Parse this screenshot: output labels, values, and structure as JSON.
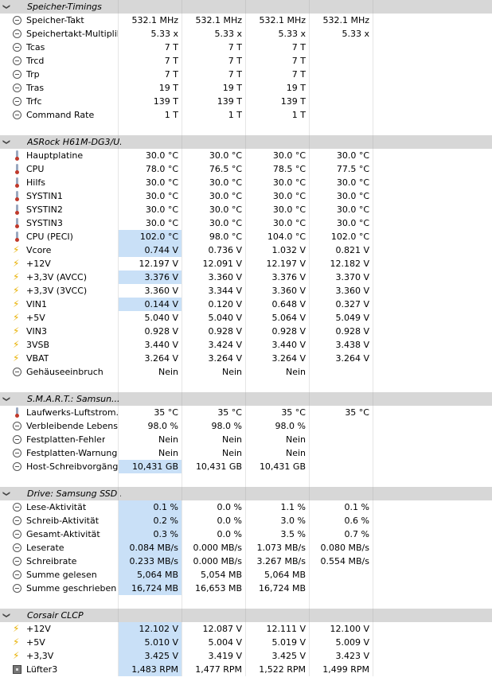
{
  "groups": [
    {
      "title": "Speicher-Timings",
      "rows": [
        {
          "icon": "clock-icon",
          "label": "Speicher-Takt",
          "values": [
            "532.1 MHz",
            "532.1 MHz",
            "532.1 MHz",
            "532.1 MHz"
          ]
        },
        {
          "icon": "clock-icon",
          "label": "Speichertakt-Multiplik...",
          "values": [
            "5.33 x",
            "5.33 x",
            "5.33 x",
            "5.33 x"
          ]
        },
        {
          "icon": "clock-icon",
          "label": "Tcas",
          "values": [
            "7 T",
            "7 T",
            "7 T",
            ""
          ]
        },
        {
          "icon": "clock-icon",
          "label": "Trcd",
          "values": [
            "7 T",
            "7 T",
            "7 T",
            ""
          ]
        },
        {
          "icon": "clock-icon",
          "label": "Trp",
          "values": [
            "7 T",
            "7 T",
            "7 T",
            ""
          ]
        },
        {
          "icon": "clock-icon",
          "label": "Tras",
          "values": [
            "19 T",
            "19 T",
            "19 T",
            ""
          ]
        },
        {
          "icon": "clock-icon",
          "label": "Trfc",
          "values": [
            "139 T",
            "139 T",
            "139 T",
            ""
          ]
        },
        {
          "icon": "clock-icon",
          "label": "Command Rate",
          "values": [
            "1 T",
            "1 T",
            "1 T",
            ""
          ]
        }
      ]
    },
    {
      "title": "ASRock H61M-DG3/U...",
      "rows": [
        {
          "icon": "thermometer-icon",
          "label": "Hauptplatine",
          "values": [
            "30.0 °C",
            "30.0 °C",
            "30.0 °C",
            "30.0 °C"
          ]
        },
        {
          "icon": "thermometer-icon",
          "label": "CPU",
          "values": [
            "78.0 °C",
            "76.5 °C",
            "78.5 °C",
            "77.5 °C"
          ]
        },
        {
          "icon": "thermometer-icon",
          "label": "Hilfs",
          "values": [
            "30.0 °C",
            "30.0 °C",
            "30.0 °C",
            "30.0 °C"
          ]
        },
        {
          "icon": "thermometer-icon",
          "label": "SYSTIN1",
          "values": [
            "30.0 °C",
            "30.0 °C",
            "30.0 °C",
            "30.0 °C"
          ]
        },
        {
          "icon": "thermometer-icon",
          "label": "SYSTIN2",
          "values": [
            "30.0 °C",
            "30.0 °C",
            "30.0 °C",
            "30.0 °C"
          ]
        },
        {
          "icon": "thermometer-icon",
          "label": "SYSTIN3",
          "values": [
            "30.0 °C",
            "30.0 °C",
            "30.0 °C",
            "30.0 °C"
          ]
        },
        {
          "icon": "thermometer-icon",
          "label": "CPU (PECI)",
          "values": [
            "102.0 °C",
            "98.0 °C",
            "104.0 °C",
            "102.0 °C"
          ],
          "hl": true
        },
        {
          "icon": "voltage-icon",
          "label": "Vcore",
          "values": [
            "0.744 V",
            "0.736 V",
            "1.032 V",
            "0.821 V"
          ],
          "hl": true
        },
        {
          "icon": "voltage-icon",
          "label": "+12V",
          "values": [
            "12.197 V",
            "12.091 V",
            "12.197 V",
            "12.182 V"
          ]
        },
        {
          "icon": "voltage-icon",
          "label": "+3,3V (AVCC)",
          "values": [
            "3.376 V",
            "3.360 V",
            "3.376 V",
            "3.370 V"
          ],
          "hl": true
        },
        {
          "icon": "voltage-icon",
          "label": "+3,3V (3VCC)",
          "values": [
            "3.360 V",
            "3.344 V",
            "3.360 V",
            "3.360 V"
          ]
        },
        {
          "icon": "voltage-icon",
          "label": "VIN1",
          "values": [
            "0.144 V",
            "0.120 V",
            "0.648 V",
            "0.327 V"
          ],
          "hl": true
        },
        {
          "icon": "voltage-icon",
          "label": "+5V",
          "values": [
            "5.040 V",
            "5.040 V",
            "5.064 V",
            "5.049 V"
          ]
        },
        {
          "icon": "voltage-icon",
          "label": "VIN3",
          "values": [
            "0.928 V",
            "0.928 V",
            "0.928 V",
            "0.928 V"
          ]
        },
        {
          "icon": "voltage-icon",
          "label": "3VSB",
          "values": [
            "3.440 V",
            "3.424 V",
            "3.440 V",
            "3.438 V"
          ]
        },
        {
          "icon": "voltage-icon",
          "label": "VBAT",
          "values": [
            "3.264 V",
            "3.264 V",
            "3.264 V",
            "3.264 V"
          ]
        },
        {
          "icon": "clock-icon",
          "label": "Gehäuseeinbruch",
          "values": [
            "Nein",
            "Nein",
            "Nein",
            ""
          ]
        }
      ]
    },
    {
      "title": "S.M.A.R.T.: Samsun...",
      "rows": [
        {
          "icon": "thermometer-icon",
          "label": "Laufwerks-Luftstrom...",
          "values": [
            "35 °C",
            "35 °C",
            "35 °C",
            "35 °C"
          ]
        },
        {
          "icon": "clock-icon",
          "label": "Verbleibende Lebens...",
          "values": [
            "98.0 %",
            "98.0 %",
            "98.0 %",
            ""
          ]
        },
        {
          "icon": "clock-icon",
          "label": "Festplatten-Fehler",
          "values": [
            "Nein",
            "Nein",
            "Nein",
            ""
          ]
        },
        {
          "icon": "clock-icon",
          "label": "Festplatten-Warnung",
          "values": [
            "Nein",
            "Nein",
            "Nein",
            ""
          ]
        },
        {
          "icon": "clock-icon",
          "label": "Host-Schreibvorgäng...",
          "values": [
            "10,431 GB",
            "10,431 GB",
            "10,431 GB",
            ""
          ],
          "hl": true
        }
      ]
    },
    {
      "title": "Drive: Samsung SSD ...",
      "rows": [
        {
          "icon": "clock-icon",
          "label": "Lese-Aktivität",
          "values": [
            "0.1 %",
            "0.0 %",
            "1.1 %",
            "0.1 %"
          ],
          "hl": true
        },
        {
          "icon": "clock-icon",
          "label": "Schreib-Aktivität",
          "values": [
            "0.2 %",
            "0.0 %",
            "3.0 %",
            "0.6 %"
          ],
          "hl": true
        },
        {
          "icon": "clock-icon",
          "label": "Gesamt-Aktivität",
          "values": [
            "0.3 %",
            "0.0 %",
            "3.5 %",
            "0.7 %"
          ],
          "hl": true
        },
        {
          "icon": "clock-icon",
          "label": "Leserate",
          "values": [
            "0.084 MB/s",
            "0.000 MB/s",
            "1.073 MB/s",
            "0.080 MB/s"
          ],
          "hl": true
        },
        {
          "icon": "clock-icon",
          "label": "Schreibrate",
          "values": [
            "0.233 MB/s",
            "0.000 MB/s",
            "3.267 MB/s",
            "0.554 MB/s"
          ],
          "hl": true
        },
        {
          "icon": "clock-icon",
          "label": "Summe gelesen",
          "values": [
            "5,064 MB",
            "5,054 MB",
            "5,064 MB",
            ""
          ],
          "hl": true
        },
        {
          "icon": "clock-icon",
          "label": "Summe geschrieben",
          "values": [
            "16,724 MB",
            "16,653 MB",
            "16,724 MB",
            ""
          ],
          "hl": true
        }
      ]
    },
    {
      "title": "Corsair CLCP",
      "rows": [
        {
          "icon": "voltage-icon",
          "label": "+12V",
          "values": [
            "12.102 V",
            "12.087 V",
            "12.111 V",
            "12.100 V"
          ],
          "hl": true
        },
        {
          "icon": "voltage-icon",
          "label": "+5V",
          "values": [
            "5.010 V",
            "5.004 V",
            "5.019 V",
            "5.009 V"
          ],
          "hl": true
        },
        {
          "icon": "voltage-icon",
          "label": "+3,3V",
          "values": [
            "3.425 V",
            "3.419 V",
            "3.425 V",
            "3.423 V"
          ],
          "hl": true
        },
        {
          "icon": "fan-icon",
          "label": "Lüfter3",
          "values": [
            "1,483 RPM",
            "1,477 RPM",
            "1,522 RPM",
            "1,499 RPM"
          ],
          "hl": true
        }
      ]
    }
  ],
  "colors": {
    "highlight": "#c9e0f7",
    "group_header": "#d7d7d7",
    "voltage_icon": "#e8b000"
  }
}
